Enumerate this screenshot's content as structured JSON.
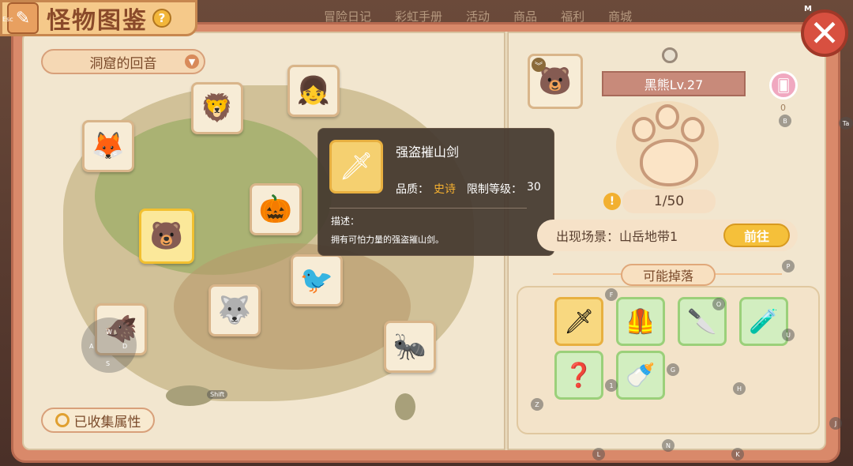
{
  "header": {
    "title": "怪物图鉴",
    "help": "?",
    "esc": "Esc"
  },
  "top_menu": [
    "冒险日记",
    "彩虹手册",
    "活动",
    "商品",
    "福利",
    "商城"
  ],
  "close": {
    "label": "✕",
    "hotkey": "M"
  },
  "region": {
    "value": "洞窟的回音"
  },
  "collect_button": {
    "label": "已收集属性"
  },
  "joystick": {
    "w": "W",
    "a": "A",
    "s": "S",
    "d": "D"
  },
  "shift_label": "Shift",
  "tooltip": {
    "name": "强盗摧山剑",
    "quality_label": "品质：",
    "quality_value": "史诗",
    "level_label": "限制等级：",
    "level_value": "30",
    "desc_title": "描述：",
    "desc": "拥有可怕力量的强盗摧山剑。"
  },
  "monster_detail": {
    "name": "黑熊Lv.27",
    "badge": "︾",
    "card_count": "0",
    "progress": "1/50",
    "scene_label": "出现场景：山岳地带1",
    "go_button": "前往",
    "drops_title": "可能掉落"
  },
  "hotkeys": {
    "B": "B",
    "P": "P",
    "F": "F",
    "O": "O",
    "U": "U",
    "G": "G",
    "H": "H",
    "Z": "Z",
    "one": "1",
    "J": "J",
    "L": "L",
    "N": "N",
    "K": "K",
    "Ta": "Ta"
  },
  "icons": {
    "monsters": [
      "fox-warrior-icon",
      "lion-beast-icon",
      "blue-hair-girl-icon",
      "pumpkin-witch-icon",
      "black-bear-icon",
      "crow-bird-icon",
      "werewolf-icon",
      "boar-icon",
      "ant-lancer-icon"
    ],
    "drops": [
      "bandit-sword-icon",
      "armor-vest-icon",
      "dagger-icon",
      "potion-icon",
      "mystery-card-icon",
      "milk-bottle-icon"
    ]
  },
  "colors": {
    "accent": "#f5c03a",
    "epic": "#f5b030",
    "drop_border": "#9bd07a"
  }
}
